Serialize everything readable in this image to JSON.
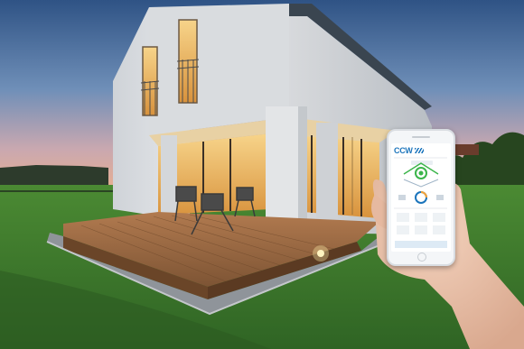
{
  "image": {
    "scene": "modern-house-at-dusk",
    "app": {
      "logo_text": "CCW",
      "colors": {
        "accent": "#1c75bc",
        "status_green": "#3bb54a",
        "sky_top": "#3b5f8f",
        "sky_horizon": "#e9a98f",
        "lawn": "#3e7a2e",
        "deck": "#9a6a45",
        "window_glow": "#f2b85c"
      }
    }
  }
}
